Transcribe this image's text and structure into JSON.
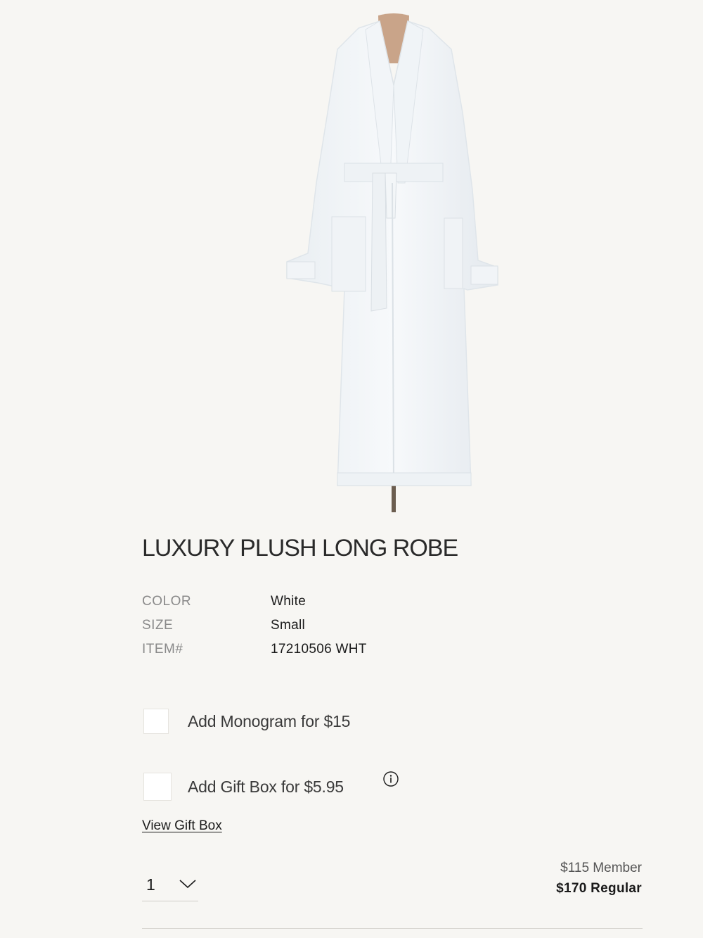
{
  "product": {
    "image_alt": "White plush long robe on a dress form",
    "title": "LUXURY PLUSH LONG ROBE"
  },
  "specs": [
    {
      "label": "COLOR",
      "value": "White"
    },
    {
      "label": "SIZE",
      "value": "Small"
    },
    {
      "label": "ITEM#",
      "value": "17210506 WHT"
    }
  ],
  "options": {
    "monogram_label": "Add Monogram for $15",
    "gift_box_label": "Add Gift Box for $5.95",
    "view_gift_box_link": "View Gift Box"
  },
  "quantity": {
    "selected": "1"
  },
  "pricing": {
    "member": "$115 Member",
    "regular": "$170 Regular"
  },
  "colors": {
    "background": "#f7f6f3",
    "text": "#1a1a1a",
    "muted": "#8a8a8a"
  },
  "icons": [
    "info-icon",
    "chevron-down-icon"
  ]
}
